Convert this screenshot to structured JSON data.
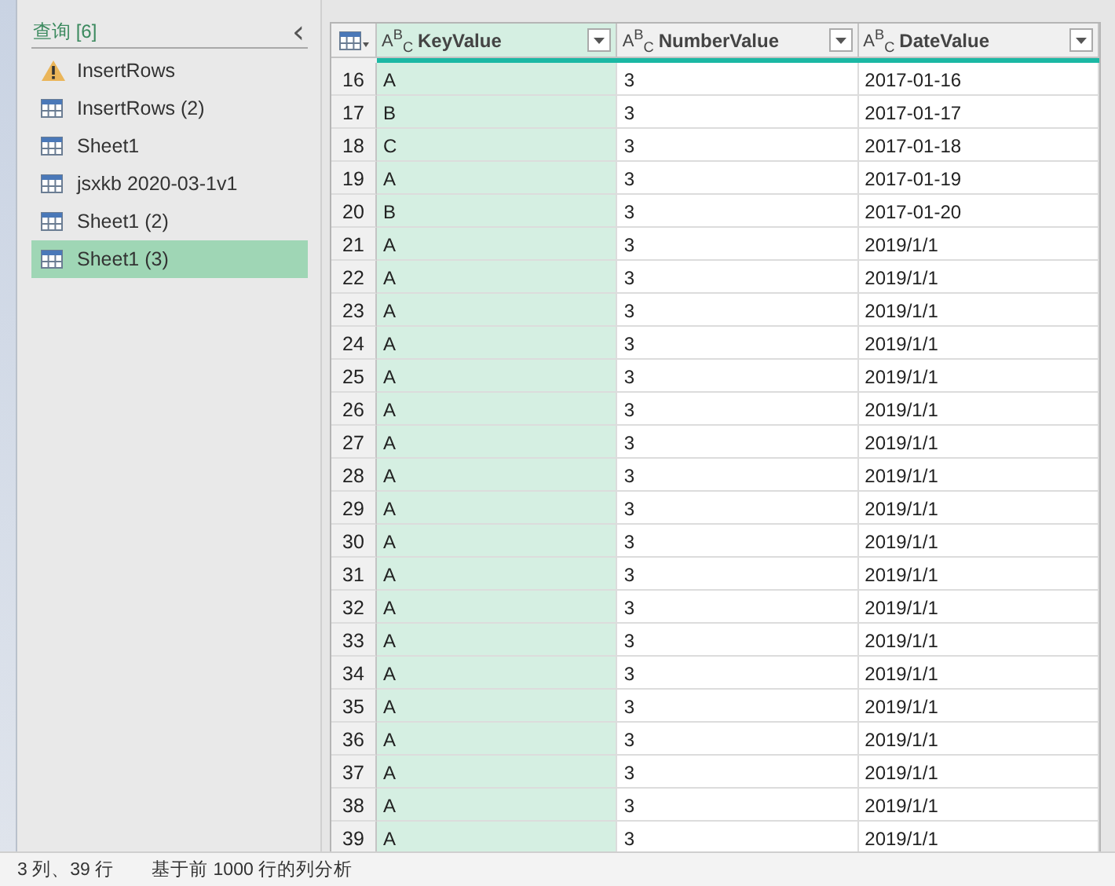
{
  "queries_pane": {
    "title": "查询 [6]",
    "collapse_glyph": "‹",
    "items": [
      {
        "label": "InsertRows",
        "kind": "warning",
        "selected": false
      },
      {
        "label": "InsertRows (2)",
        "kind": "table",
        "selected": false
      },
      {
        "label": "Sheet1",
        "kind": "table",
        "selected": false
      },
      {
        "label": "jsxkb 2020-03-1v1",
        "kind": "table",
        "selected": false
      },
      {
        "label": "Sheet1 (2)",
        "kind": "table",
        "selected": false
      },
      {
        "label": "Sheet1 (3)",
        "kind": "table",
        "selected": true
      }
    ]
  },
  "table": {
    "columns": [
      {
        "type_label": "A$^{B}$$_{C}$",
        "name": "KeyValue",
        "selected": true
      },
      {
        "type_label": "A$^{B}$$_{C}$",
        "name": "NumberValue",
        "selected": false
      },
      {
        "type_label": "A$^{B}$$_{C}$",
        "name": "DateValue",
        "selected": false
      }
    ],
    "rows": [
      {
        "index": "16",
        "cells": [
          "A",
          "3",
          "2017-01-16"
        ]
      },
      {
        "index": "17",
        "cells": [
          "B",
          "3",
          "2017-01-17"
        ]
      },
      {
        "index": "18",
        "cells": [
          "C",
          "3",
          "2017-01-18"
        ]
      },
      {
        "index": "19",
        "cells": [
          "A",
          "3",
          "2017-01-19"
        ]
      },
      {
        "index": "20",
        "cells": [
          "B",
          "3",
          "2017-01-20"
        ]
      },
      {
        "index": "21",
        "cells": [
          "A",
          "3",
          "2019/1/1"
        ]
      },
      {
        "index": "22",
        "cells": [
          "A",
          "3",
          "2019/1/1"
        ]
      },
      {
        "index": "23",
        "cells": [
          "A",
          "3",
          "2019/1/1"
        ]
      },
      {
        "index": "24",
        "cells": [
          "A",
          "3",
          "2019/1/1"
        ]
      },
      {
        "index": "25",
        "cells": [
          "A",
          "3",
          "2019/1/1"
        ]
      },
      {
        "index": "26",
        "cells": [
          "A",
          "3",
          "2019/1/1"
        ]
      },
      {
        "index": "27",
        "cells": [
          "A",
          "3",
          "2019/1/1"
        ]
      },
      {
        "index": "28",
        "cells": [
          "A",
          "3",
          "2019/1/1"
        ]
      },
      {
        "index": "29",
        "cells": [
          "A",
          "3",
          "2019/1/1"
        ]
      },
      {
        "index": "30",
        "cells": [
          "A",
          "3",
          "2019/1/1"
        ]
      },
      {
        "index": "31",
        "cells": [
          "A",
          "3",
          "2019/1/1"
        ]
      },
      {
        "index": "32",
        "cells": [
          "A",
          "3",
          "2019/1/1"
        ]
      },
      {
        "index": "33",
        "cells": [
          "A",
          "3",
          "2019/1/1"
        ]
      },
      {
        "index": "34",
        "cells": [
          "A",
          "3",
          "2019/1/1"
        ]
      },
      {
        "index": "35",
        "cells": [
          "A",
          "3",
          "2019/1/1"
        ]
      },
      {
        "index": "36",
        "cells": [
          "A",
          "3",
          "2019/1/1"
        ]
      },
      {
        "index": "37",
        "cells": [
          "A",
          "3",
          "2019/1/1"
        ]
      },
      {
        "index": "38",
        "cells": [
          "A",
          "3",
          "2019/1/1"
        ]
      },
      {
        "index": "39",
        "cells": [
          "A",
          "3",
          "2019/1/1"
        ]
      }
    ]
  },
  "status_bar": {
    "summary": "3 列、39 行",
    "profiling": "基于前 1000 行的列分析"
  }
}
